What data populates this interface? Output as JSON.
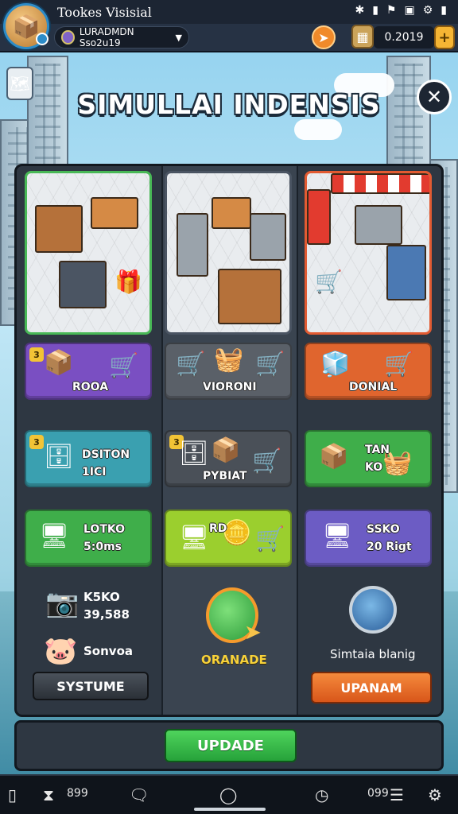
{
  "status_bar": {
    "title": "Tookes Visisial",
    "icons": [
      "bluetooth-icon",
      "signal-icon",
      "flag-icon",
      "image-icon",
      "settings-icon",
      "battery-icon"
    ]
  },
  "top_bar": {
    "account_name": "LURADMDN Sso2u19",
    "currency_value": "0.2019",
    "plus_label": "+"
  },
  "header": {
    "game_title": "SIMULLAI INDENSIS",
    "close_label": "✕"
  },
  "tiles": [
    {
      "label": "ROOA",
      "badge": "3",
      "color": "#7a4fc2"
    },
    {
      "label": "VIORONI",
      "badge": "",
      "color": "#5a6068"
    },
    {
      "label": "DONIAL",
      "badge": "",
      "color": "#e0652e"
    },
    {
      "label": "DSITON\n1ICI",
      "badge": "3",
      "color": "#3aa0b0"
    },
    {
      "label": "PYBIAT",
      "badge": "3",
      "color": "#4a5058"
    },
    {
      "label": "TAN\nKO",
      "badge": "",
      "color": "#3fae4a"
    },
    {
      "label": "LOTKO\n5:0ms",
      "badge": "",
      "color": "#3fae4a"
    },
    {
      "label": "RD",
      "badge": "",
      "color": "#9bcf2e"
    },
    {
      "label": "SSKO\n20 Rigt",
      "badge": "",
      "color": "#6c5cc4"
    }
  ],
  "stats": {
    "stat1_label": "K5KO",
    "stat1_value": "39,588",
    "stat2_label": "Sonvoa",
    "system_button": "SYSTUME",
    "upgrade_label": "ORANADE",
    "skill_label": "Simtaia blanig",
    "skill_button": "UPANAM"
  },
  "footer": {
    "update_button": "UPDADE"
  },
  "nav": {
    "left_text": "899",
    "right_text": "099"
  }
}
